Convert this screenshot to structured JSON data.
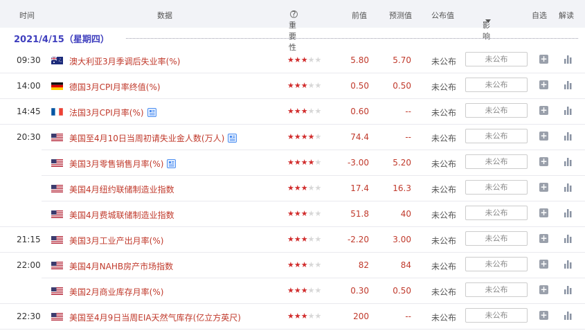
{
  "header": {
    "time": "时间",
    "data": "数据",
    "importance": "重要性",
    "previous": "前值",
    "forecast": "预测值",
    "actual": "公布值",
    "impact": "影响",
    "watch": "自选",
    "interpret": "解读"
  },
  "date_label": "2021/4/15（星期四）",
  "colors": {
    "accent": "#3f3fbe",
    "event_red": "#c0392b",
    "star_on": "#d12d2d",
    "star_off": "#d7d7d7"
  },
  "rows": [
    {
      "time": "09:30",
      "flag": "australia-flag-icon",
      "event": "澳大利亚3月季调后失业率(%)",
      "stars": 3,
      "previous": "5.80",
      "forecast": "5.70",
      "actual": "未公布",
      "impact_box": "未公布",
      "doc": false
    },
    {
      "time": "14:00",
      "flag": "germany-flag-icon",
      "event": "德国3月CPI月率终值(%)",
      "stars": 3,
      "previous": "0.50",
      "forecast": "0.50",
      "actual": "未公布",
      "impact_box": "未公布",
      "doc": false
    },
    {
      "time": "14:45",
      "flag": "france-flag-icon",
      "event": "法国3月CPI月率(%)",
      "stars": 3,
      "previous": "0.60",
      "forecast": "--",
      "actual": "未公布",
      "impact_box": "未公布",
      "doc": true
    },
    {
      "time": "20:30",
      "flag": "usa-flag-icon",
      "event": "美国至4月10日当周初请失业金人数(万人)",
      "stars": 4,
      "previous": "74.4",
      "forecast": "--",
      "actual": "未公布",
      "impact_box": "未公布",
      "doc": true
    },
    {
      "time": "",
      "flag": "usa-flag-icon",
      "event": "美国3月零售销售月率(%)",
      "stars": 4,
      "previous": "-3.00",
      "forecast": "5.20",
      "actual": "未公布",
      "impact_box": "未公布",
      "doc": true
    },
    {
      "time": "",
      "flag": "usa-flag-icon",
      "event": "美国4月纽约联储制造业指数",
      "stars": 3,
      "previous": "17.4",
      "forecast": "16.3",
      "actual": "未公布",
      "impact_box": "未公布",
      "doc": false
    },
    {
      "time": "",
      "flag": "usa-flag-icon",
      "event": "美国4月费城联储制造业指数",
      "stars": 3,
      "previous": "51.8",
      "forecast": "40",
      "actual": "未公布",
      "impact_box": "未公布",
      "doc": false
    },
    {
      "time": "21:15",
      "flag": "usa-flag-icon",
      "event": "美国3月工业产出月率(%)",
      "stars": 3,
      "previous": "-2.20",
      "forecast": "3.00",
      "actual": "未公布",
      "impact_box": "未公布",
      "doc": false
    },
    {
      "time": "22:00",
      "flag": "usa-flag-icon",
      "event": "美国4月NAHB房产市场指数",
      "stars": 3,
      "previous": "82",
      "forecast": "84",
      "actual": "未公布",
      "impact_box": "未公布",
      "doc": false
    },
    {
      "time": "",
      "flag": "usa-flag-icon",
      "event": "美国2月商业库存月率(%)",
      "stars": 3,
      "previous": "0.30",
      "forecast": "0.50",
      "actual": "未公布",
      "impact_box": "未公布",
      "doc": false
    },
    {
      "time": "22:30",
      "flag": "usa-flag-icon",
      "event": "美国至4月9日当周EIA天然气库存(亿立方英尺)",
      "stars": 3,
      "previous": "200",
      "forecast": "--",
      "actual": "未公布",
      "impact_box": "未公布",
      "doc": false
    }
  ]
}
